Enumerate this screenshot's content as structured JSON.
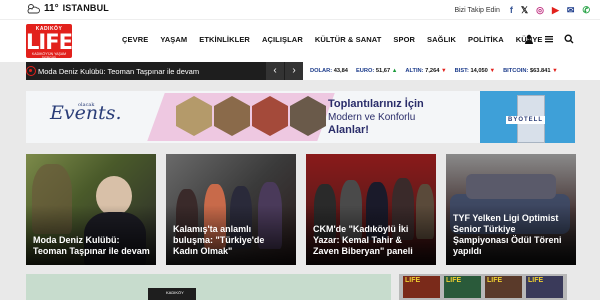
{
  "weather": {
    "temperature": "11°",
    "city": "ISTANBUL",
    "icon": "sun-cloud-icon"
  },
  "follow": {
    "label": "Bizi Takip Edin",
    "social": [
      {
        "name": "facebook-icon",
        "glyph": "f",
        "color": "#3b5998"
      },
      {
        "name": "x-icon",
        "glyph": "𝕏",
        "color": "#111111"
      },
      {
        "name": "instagram-icon",
        "glyph": "◎",
        "color": "#c13584"
      },
      {
        "name": "youtube-icon",
        "glyph": "▶",
        "color": "#e2211c"
      },
      {
        "name": "email-icon",
        "glyph": "✉",
        "color": "#1a3a8a"
      },
      {
        "name": "whatsapp-icon",
        "glyph": "✆",
        "color": "#25a244"
      }
    ]
  },
  "logo": {
    "top": "KADIKÖY",
    "main": "LIFE",
    "sub": "KADIKÖY'ÜN YAŞAM DERGİSİ"
  },
  "nav": [
    "ÇEVRE",
    "YAŞAM",
    "ETKİNLİKLER",
    "AÇILIŞLAR",
    "KÜLTÜR & SANAT",
    "SPOR",
    "SAĞLIK",
    "POLİTİKA",
    "KÜNYE"
  ],
  "ticker": {
    "text": "Moda Deniz Kulübü: Teoman Taşpınar ile devam",
    "prev": "‹",
    "next": "›"
  },
  "rates": [
    {
      "label": "DOLAR:",
      "value": "43,84",
      "trend": ""
    },
    {
      "label": "EURO:",
      "value": "51,67",
      "trend": "▲",
      "dir": "up"
    },
    {
      "label": "ALTIN:",
      "value": "7,264",
      "trend": "▼",
      "dir": "down"
    },
    {
      "label": "BIST:",
      "value": "14,050",
      "trend": "▼",
      "dir": "down"
    },
    {
      "label": "BITCOIN:",
      "value": "$63.841",
      "trend": "▼",
      "dir": "down"
    }
  ],
  "banner": {
    "brand_top": "olacak",
    "brand": "Events.",
    "line1": "Toplantılarınız İçin",
    "line2": "Modern ve Konforlu",
    "line3": "Alanlar!",
    "hotel": "BYOTELL"
  },
  "cards": [
    {
      "title": "Moda Deniz Kulübü: Teoman Taşpınar ile devam"
    },
    {
      "title": "Kalamış'ta anlamlı buluşma: \"Türkiye'de Kadın Olmak\""
    },
    {
      "title": "CKM'de \"Kadıköylü İki Yazar: Kemal Tahir & Zaven Biberyan\" paneli"
    },
    {
      "title": "TYF Yelken Ligi Optimist Senior Türkiye Şampiyonası Ödül Töreni yapıldı"
    }
  ],
  "bottom": {
    "tab_logo": "KADIKÖY",
    "magazines": [
      "LIFE",
      "LIFE",
      "LIFE",
      "LIFE"
    ]
  }
}
